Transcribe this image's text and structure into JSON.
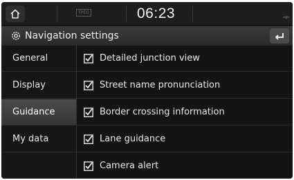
{
  "status_bar": {
    "tpeg_label": "TPEG",
    "time": "06:23"
  },
  "header": {
    "title": "Navigation settings",
    "icons": [
      "home-icon",
      "gear-icon",
      "back-icon",
      "signal-icon"
    ]
  },
  "nav": {
    "items": [
      {
        "label": "General"
      },
      {
        "label": "Display"
      },
      {
        "label": "Guidance",
        "selected": true
      },
      {
        "label": "My data"
      }
    ]
  },
  "options": [
    {
      "label": "Detailed junction view",
      "checked": true
    },
    {
      "label": "Street name pronunciation",
      "checked": true
    },
    {
      "label": "Border crossing information",
      "checked": true
    },
    {
      "label": "Lane guidance",
      "checked": true
    },
    {
      "label": "Camera alert",
      "checked": true
    }
  ],
  "colors": {
    "background": "#141414",
    "selected_nav": "#404040",
    "text": "#e8e8e8"
  }
}
